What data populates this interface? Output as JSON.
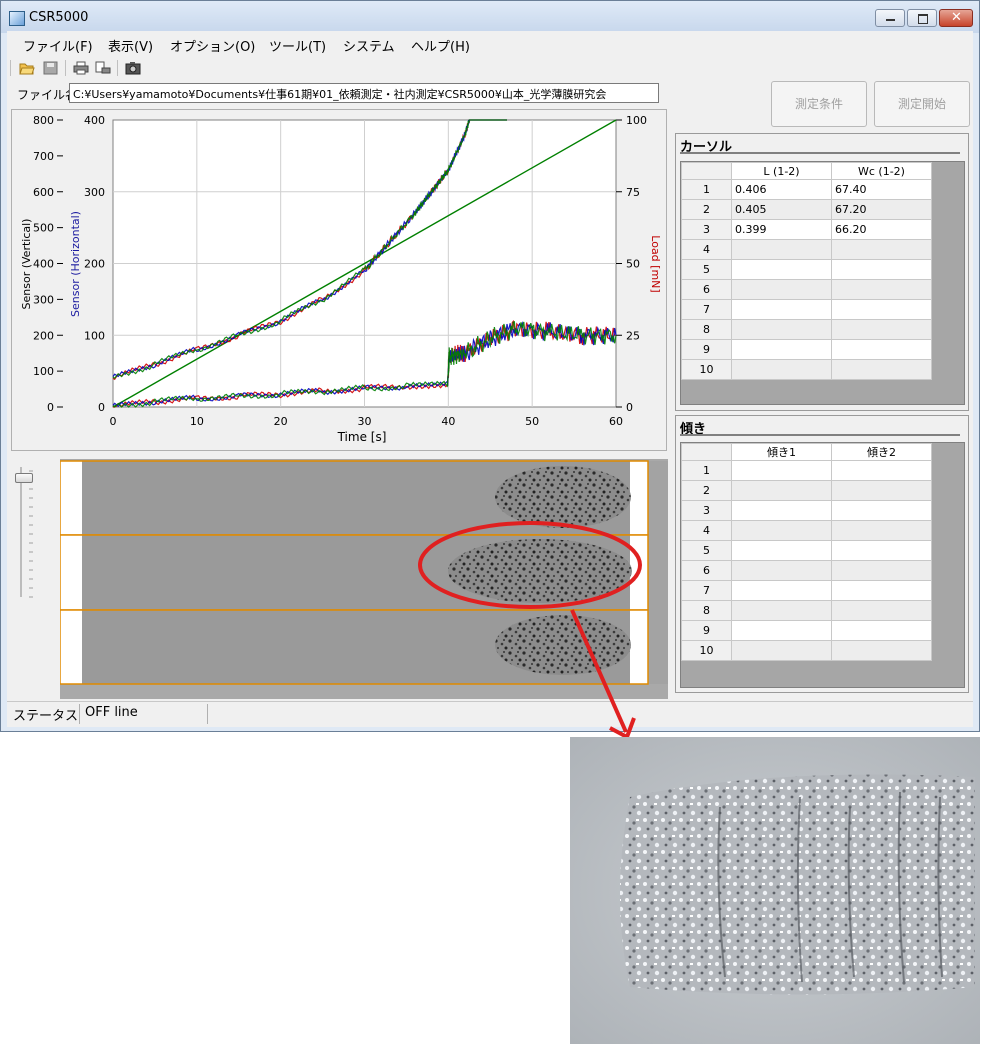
{
  "window": {
    "title": "CSR5000"
  },
  "menu": [
    "ファイル(F)",
    "表示(V)",
    "オプション(O)",
    "ツール(T)",
    "システム",
    "ヘルプ(H)"
  ],
  "toolbar": {
    "icons": [
      "open-folder-icon",
      "save-icon",
      "print-icon",
      "print-preview-icon",
      "camera-icon"
    ]
  },
  "file": {
    "label": "ファイル名",
    "path": "C:¥Users¥yamamoto¥Documents¥仕事61期¥01_依頼測定・社内測定¥CSR5000¥山本_光学薄膜研究会"
  },
  "buttons": {
    "conditions": "測定条件",
    "start": "測定開始"
  },
  "chart_data": {
    "type": "line",
    "xlabel": "Time [s]",
    "ylabel_vertical": "Sensor (Vertical)",
    "ylabel_horizontal": "Sensor (Horizontal)",
    "ylabel_right": "Load [mN]",
    "xlim": [
      0,
      60
    ],
    "x_ticks": [
      "0",
      "10",
      "20",
      "30",
      "40",
      "50",
      "60"
    ],
    "y_vertical_ticks": [
      "800",
      "700",
      "600",
      "500",
      "400",
      "300",
      "200",
      "100",
      "0"
    ],
    "y_horizontal_ticks": [
      "400",
      "300",
      "200",
      "100",
      "0"
    ],
    "y_right_ticks": [
      "100",
      "75",
      "50",
      "25",
      "0"
    ],
    "y_vertical_lim": [
      0,
      800
    ],
    "y_horizontal_lim": [
      0,
      400
    ],
    "y_right_lim": [
      0,
      100
    ],
    "series": [
      {
        "color": "#008000",
        "axis": "right",
        "x": [
          0,
          60
        ],
        "y": [
          0,
          100
        ]
      },
      {
        "color": "#008000",
        "axis": "horizontal",
        "x": [
          0,
          5,
          10,
          15,
          20,
          25,
          30,
          33,
          36,
          38,
          40,
          42,
          43,
          44,
          45,
          46,
          47
        ],
        "y": [
          40,
          60,
          80,
          100,
          120,
          150,
          190,
          230,
          270,
          300,
          330,
          380,
          420,
          480,
          520,
          600,
          660
        ]
      },
      {
        "color": "#008000",
        "axis": "horizontal",
        "x": [
          0,
          5,
          10,
          15,
          20,
          25,
          30,
          35,
          39.9,
          40.1,
          42,
          45,
          48,
          52,
          56,
          60
        ],
        "y": [
          0,
          8,
          12,
          15,
          18,
          22,
          26,
          29,
          31,
          70,
          75,
          95,
          110,
          105,
          100,
          100
        ]
      }
    ],
    "line_colors": [
      "#008000",
      "#0000c0",
      "#d00000"
    ]
  },
  "cursor_panel": {
    "title": "カーソル",
    "columns": [
      "L (1-2)",
      "Wc (1-2)"
    ],
    "row_numbers": [
      "1",
      "2",
      "3",
      "4",
      "5",
      "6",
      "7",
      "8",
      "9",
      "10"
    ],
    "rows": [
      [
        "0.406",
        "67.40"
      ],
      [
        "0.405",
        "67.20"
      ],
      [
        "0.399",
        "66.20"
      ],
      [
        "",
        ""
      ],
      [
        "",
        ""
      ],
      [
        "",
        ""
      ],
      [
        "",
        ""
      ],
      [
        "",
        ""
      ],
      [
        "",
        ""
      ],
      [
        "",
        ""
      ]
    ]
  },
  "slope_panel": {
    "title": "傾き",
    "columns": [
      "傾き1",
      "傾き2"
    ],
    "row_numbers": [
      "1",
      "2",
      "3",
      "4",
      "5",
      "6",
      "7",
      "8",
      "9",
      "10"
    ]
  },
  "status": {
    "label": "ステータス",
    "value": "OFF line"
  },
  "colors": {
    "annotation": "#e02020",
    "strip_border": "#e08a00",
    "plot_bg": "#ffffff"
  }
}
